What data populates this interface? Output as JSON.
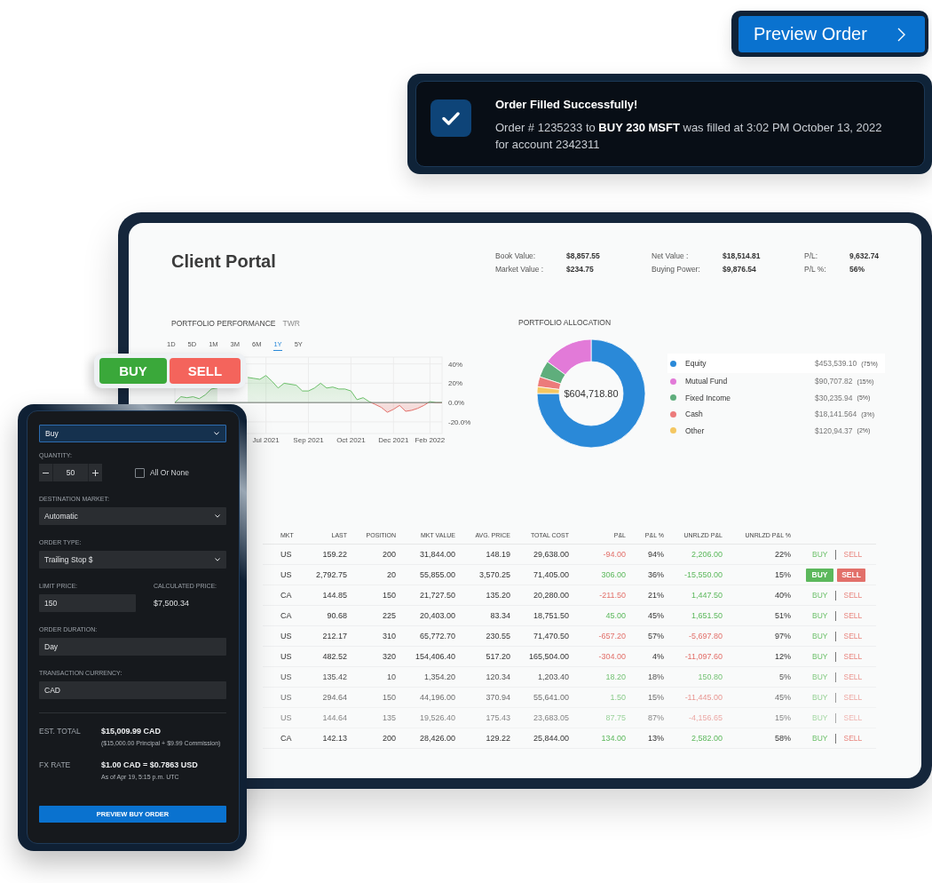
{
  "preview_button": {
    "label": "Preview Order"
  },
  "notification": {
    "title": "Order Filled Successfully!",
    "message": "Order # 1235233 to **BUY 230 MSFT** was filled at 3:02 PM October 13, 2022 for account 2342311"
  },
  "portal": {
    "title": "Client Portal",
    "summary": [
      {
        "items": [
          {
            "label": "Book Value:",
            "value": "$8,857.55"
          },
          {
            "label": "Market Value :",
            "value": "$234.75"
          }
        ]
      },
      {
        "items": [
          {
            "label": "Net Value :",
            "value": "$18,514.81"
          },
          {
            "label": "Buying Power:",
            "value": "$9,876.54"
          }
        ]
      },
      {
        "items": [
          {
            "label": "P/L:",
            "value": "9,632.74"
          },
          {
            "label": "P/L %:",
            "value": "56%"
          }
        ]
      }
    ]
  },
  "performance": {
    "subtitle": "TWR",
    "ranges": [
      {
        "label": "1D",
        "selected": false
      },
      {
        "label": "5D",
        "selected": false
      },
      {
        "label": "1M",
        "selected": false
      },
      {
        "label": "3M",
        "selected": false
      },
      {
        "label": "6M",
        "selected": false
      },
      {
        "label": "1Y",
        "selected": true
      },
      {
        "label": "5Y",
        "selected": false
      }
    ],
    "chart_data": {
      "type": "area",
      "title": "PORTFOLIO PERFORMANCE",
      "grid": true,
      "categories": [
        null,
        null,
        null,
        null,
        null,
        null,
        null,
        null,
        null,
        null,
        null,
        null,
        null,
        null,
        null,
        "Jul 2021",
        null,
        null,
        null,
        null,
        null,
        null,
        "Sep 2021",
        null,
        null,
        null,
        null,
        null,
        null,
        "Oct 2021",
        null,
        null,
        null,
        null,
        null,
        null,
        "Dec 2021",
        null,
        null,
        null,
        null,
        null,
        "Feb 2022",
        null,
        null
      ],
      "ylim": [
        -32,
        47
      ],
      "yticks": [
        {
          "value": 40,
          "label": "40%"
        },
        {
          "value": 20,
          "label": "20%"
        },
        {
          "value": 0,
          "label": "0.0%"
        },
        {
          "value": -20,
          "label": "-20.0%"
        }
      ],
      "series": [
        {
          "color": "#6cbf6a",
          "values": [
            0,
            6,
            5,
            6,
            4,
            8,
            14,
            15,
            null,
            null,
            null,
            null,
            26,
            25,
            24,
            28,
            22,
            15,
            20,
            19,
            18,
            12,
            12,
            15,
            20,
            15,
            16,
            14,
            14,
            12,
            3,
            5,
            1,
            -2,
            -5,
            -10,
            -7,
            -3,
            -9,
            -8,
            -6,
            -3,
            1,
            0,
            0
          ]
        }
      ]
    }
  },
  "allocation": {
    "total": "$604,718.80",
    "chart_data": {
      "type": "donut",
      "title": "PORTFOLIO ALLOCATION",
      "categories": [
        "Equity",
        "Mutual Fund",
        "Fixed Income",
        "Cash",
        "Other"
      ],
      "values": [
        75,
        15,
        5,
        3,
        2
      ],
      "colors": [
        "#2a89d8",
        "#e27ad8",
        "#5fae7c",
        "#ec7b7b",
        "#f4c762"
      ]
    },
    "legend": [
      {
        "amount": "$453,539.10",
        "share": "(75%)",
        "selected": true
      },
      {
        "amount": "$90,707.82",
        "share": "(15%)",
        "selected": false
      },
      {
        "amount": "$30,235.94",
        "share": "(5%)",
        "selected": false
      },
      {
        "amount": "$18,141.564",
        "share": "(3%)",
        "selected": false
      },
      {
        "amount": "$120,94.37",
        "share": "(2%)",
        "selected": false
      }
    ]
  },
  "holdings": {
    "columns": [
      "MKT",
      "LAST",
      "POSITION",
      "MKT VALUE",
      "AVG. PRICE",
      "TOTAL COST",
      "P&L",
      "P&L %",
      "UNRLZD P&L",
      "UNRLZD P&L %"
    ],
    "rows": [
      {
        "cells": [
          "US",
          "159.22",
          "200",
          "31,844.00",
          "148.19",
          "29,638.00",
          "-94.00",
          "94%",
          "2,206.00",
          "22%"
        ],
        "pl_gain": false,
        "unrealized_gain": true,
        "actions": [
          "BUY",
          "SELL"
        ],
        "hovered": false
      },
      {
        "cells": [
          "US",
          "2,792.75",
          "20",
          "55,855.00",
          "3,570.25",
          "71,405.00",
          "306.00",
          "36%",
          "-15,550.00",
          "15%"
        ],
        "pl_gain": true,
        "unrealized_gain": true,
        "actions": [
          "BUY",
          "SELL"
        ],
        "hovered": true
      },
      {
        "cells": [
          "CA",
          "144.85",
          "150",
          "21,727.50",
          "135.20",
          "20,280.00",
          "-211.50",
          "21%",
          "1,447.50",
          "40%"
        ],
        "pl_gain": false,
        "unrealized_gain": true,
        "actions": [
          "BUY",
          "SELL"
        ],
        "hovered": false
      },
      {
        "cells": [
          "CA",
          "90.68",
          "225",
          "20,403.00",
          "83.34",
          "18,751.50",
          "45.00",
          "45%",
          "1,651.50",
          "51%"
        ],
        "pl_gain": true,
        "unrealized_gain": true,
        "actions": [
          "BUY",
          "SELL"
        ],
        "hovered": false
      },
      {
        "cells": [
          "US",
          "212.17",
          "310",
          "65,772.70",
          "230.55",
          "71,470.50",
          "-657.20",
          "57%",
          "-5,697.80",
          "97%"
        ],
        "pl_gain": false,
        "unrealized_gain": false,
        "actions": [
          "BUY",
          "SELL"
        ],
        "hovered": false
      },
      {
        "cells": [
          "US",
          "482.52",
          "320",
          "154,406.40",
          "517.20",
          "165,504.00",
          "-304.00",
          "4%",
          "-11,097.60",
          "12%"
        ],
        "pl_gain": false,
        "unrealized_gain": false,
        "actions": [
          "BUY",
          "SELL"
        ],
        "hovered": false
      },
      {
        "cells": [
          "US",
          "135.42",
          "10",
          "1,354.20",
          "120.34",
          "1,203.40",
          "18.20",
          "18%",
          "150.80",
          "5%"
        ],
        "pl_gain": true,
        "unrealized_gain": true,
        "actions": [
          "BUY",
          "SELL"
        ],
        "hovered": false
      },
      {
        "cells": [
          "US",
          "294.64",
          "150",
          "44,196.00",
          "370.94",
          "55,641.00",
          "1.50",
          "15%",
          "-11,445.00",
          "45%"
        ],
        "pl_gain": true,
        "unrealized_gain": false,
        "actions": [
          "BUY",
          "SELL"
        ],
        "hovered": false
      },
      {
        "cells": [
          "US",
          "144.64",
          "135",
          "19,526.40",
          "175.43",
          "23,683.05",
          "87.75",
          "87%",
          "-4,156.65",
          "15%"
        ],
        "pl_gain": true,
        "unrealized_gain": false,
        "actions": [
          "BUY",
          "SELL"
        ],
        "hovered": false
      },
      {
        "cells": [
          "CA",
          "142.13",
          "200",
          "28,426.00",
          "129.22",
          "25,844.00",
          "134.00",
          "13%",
          "2,582.00",
          "58%"
        ],
        "pl_gain": true,
        "unrealized_gain": true,
        "actions": [
          "BUY",
          "SELL"
        ],
        "hovered": false
      }
    ]
  },
  "side_toggle": [
    {
      "label": "BUY",
      "kind": "buy"
    },
    {
      "label": "SELL",
      "kind": "sell"
    }
  ],
  "order_ticket": {
    "side_select": {
      "value": "Buy"
    },
    "quantity": {
      "label": "QUANTITY:",
      "value": "50"
    },
    "all_or_none": {
      "label": "All Or None",
      "checked": false
    },
    "destination": {
      "label": "DESTINATION MARKET:",
      "value": "Automatic"
    },
    "order_type": {
      "label": "ORDER TYPE:",
      "value": "Trailing Stop $"
    },
    "limit_price": {
      "label": "LIMIT PRICE:",
      "value": "150"
    },
    "calculated_price": {
      "label": "CALCULATED PRICE:",
      "value": "$7,500.34"
    },
    "duration": {
      "label": "ORDER DURATION:",
      "value": "Day"
    },
    "currency": {
      "label": "TRANSACTION CURRENCY:",
      "value": "CAD"
    },
    "totals": [
      {
        "label": "EST. TOTAL",
        "value": "$15,009.99 CAD",
        "note": "($15,000.00 Principal + $9.99 Commission)"
      },
      {
        "label": "FX RATE",
        "value": "$1.00 CAD = $0.7863 USD",
        "note": "As of Apr 19, 5:15 p.m. UTC"
      }
    ],
    "submit": {
      "label": "PREVIEW BUY ORDER"
    }
  }
}
